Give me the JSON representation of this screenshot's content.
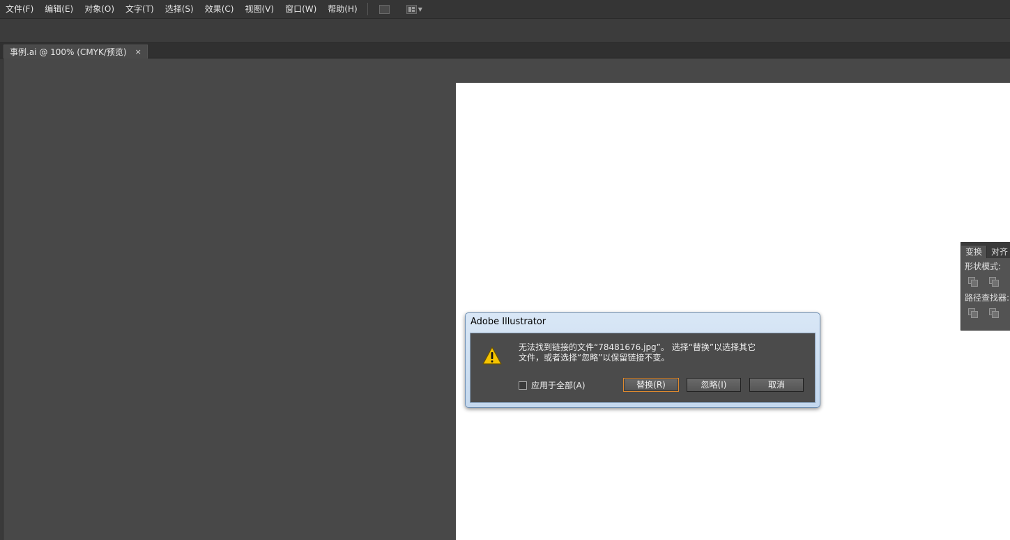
{
  "menubar": {
    "items": [
      "文件(F)",
      "编辑(E)",
      "对象(O)",
      "文字(T)",
      "选择(S)",
      "效果(C)",
      "视图(V)",
      "窗口(W)",
      "帮助(H)"
    ],
    "icons": [
      "bridge-icon",
      "arrange-documents-icon"
    ]
  },
  "document_tab": {
    "title": "事例.ai @ 100% (CMYK/预览)",
    "close": "×"
  },
  "pathfinder_panel": {
    "tabs": [
      "变换",
      "对齐"
    ],
    "shape_modes_label": "形状模式:",
    "pathfinders_label": "路径查找器:"
  },
  "dialog": {
    "title": "Adobe Illustrator",
    "message": "无法找到链接的文件“78481676.jpg”。 选择“替换”以选择其它\n文件，或者选择“忽略”以保留链接不变。",
    "apply_all_label": "应用于全部(A)",
    "apply_all_checked": false,
    "replace_label": "替换(R)",
    "ignore_label": "忽略(I)",
    "cancel_label": "取消",
    "accent_color": "#e08a2e"
  }
}
